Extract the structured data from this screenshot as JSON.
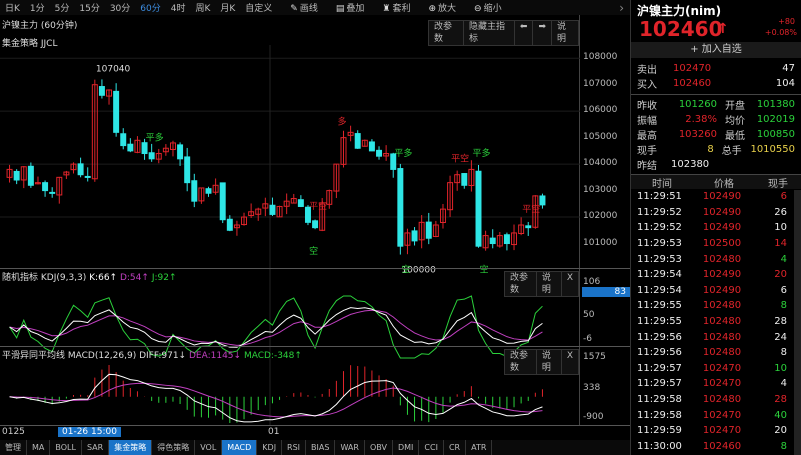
{
  "toolbar": {
    "items": [
      "日K",
      "1分",
      "5分",
      "15分",
      "30分",
      "60分",
      "4时",
      "周K",
      "月K",
      "自定义"
    ],
    "active": "60分",
    "tools": [
      {
        "icon": "pen-icon",
        "label": "画线"
      },
      {
        "icon": "layers-icon",
        "label": "叠加"
      },
      {
        "icon": "bag-icon",
        "label": "套利"
      },
      {
        "icon": "zoom-in-icon",
        "label": "放大"
      },
      {
        "icon": "zoom-out-icon",
        "label": "缩小"
      }
    ]
  },
  "main": {
    "title": "沪镍主力 (60分钟)",
    "strategy": "集金策略 JJCL",
    "buttons": [
      "改参数",
      "隐藏主指标",
      "⬅",
      "➡",
      "说明"
    ],
    "price_ticks": [
      "108000",
      "107000",
      "106000",
      "105000",
      "104000",
      "103000",
      "102000",
      "101000"
    ]
  },
  "kdj": {
    "title": "随机指标 KDJ(9,3,3)",
    "k": "K:66↑",
    "d": "D:54↑",
    "j": "J:92↑",
    "buttons": [
      "改参数",
      "说明",
      "X"
    ],
    "ticks": [
      "106",
      "50",
      "-6"
    ],
    "current": "83"
  },
  "macd": {
    "title": "平滑异同平均线 MACD(12,26,9)",
    "diff": "DIFF:971↓",
    "dea": "DEA:1145↓",
    "macd": "MACD:-348↑",
    "buttons": [
      "改参数",
      "说明",
      "X"
    ],
    "ticks": [
      "1575",
      "338",
      "-900"
    ]
  },
  "datebar": {
    "left": "0125",
    "cursor": "01-26 15:00",
    "mid": "01"
  },
  "tabs": {
    "items": [
      "管理",
      "MA",
      "BOLL",
      "SAR",
      "集金策略",
      "得色策略",
      "VOL",
      "MACD",
      "KDJ",
      "RSI",
      "BIAS",
      "WAR",
      "OBV",
      "DMI",
      "CCI",
      "CR",
      "ATR"
    ],
    "active": [
      "集金策略",
      "MACD"
    ]
  },
  "colors": {
    "up": "#e0242a",
    "down": "#2ee6e6",
    "k": "#ffffff",
    "d": "#c040c0",
    "j": "#2bd13b",
    "accent": "#1a73c8"
  },
  "chart_data": {
    "type": "candlestick",
    "closes": [
      103800,
      103400,
      103900,
      103200,
      103300,
      103000,
      102900,
      103500,
      103700,
      104000,
      103600,
      103500,
      107000,
      106600,
      106800,
      105200,
      104700,
      104500,
      104900,
      104400,
      104200,
      104400,
      104600,
      104800,
      104200,
      103300,
      102600,
      103100,
      102900,
      103200,
      101900,
      101500,
      101700,
      102000,
      102200,
      102300,
      102500,
      102100,
      102400,
      102600,
      102700,
      102400,
      101800,
      101600,
      102500,
      103000,
      104000,
      105000,
      105200,
      104600,
      104900,
      104500,
      104300,
      104400,
      103800,
      100900,
      101400,
      101100,
      101800,
      101200,
      101700,
      102300,
      103300,
      103600,
      103200,
      103800,
      100900,
      101300,
      101000,
      101300,
      101000,
      101400,
      101700,
      101600,
      102800,
      102460
    ],
    "ylim": [
      100000,
      108500
    ],
    "annotations": [
      {
        "i": 13,
        "text": "107040",
        "color": "#ddd"
      },
      {
        "i": 56,
        "text": "100000",
        "color": "#ddd"
      },
      {
        "i": 20,
        "text": "平多",
        "color": "#2bd13b"
      },
      {
        "i": 43,
        "text": "空",
        "color": "#2bd13b"
      },
      {
        "i": 43,
        "text": "平空",
        "color": "#e0242a"
      },
      {
        "i": 47,
        "text": "多",
        "color": "#e0242a"
      },
      {
        "i": 55,
        "text": "平多",
        "color": "#2bd13b"
      },
      {
        "i": 56,
        "text": "空",
        "color": "#2bd13b"
      },
      {
        "i": 63,
        "text": "平空",
        "color": "#e0242a"
      },
      {
        "i": 66,
        "text": "平多",
        "color": "#2bd13b"
      },
      {
        "i": 67,
        "text": "空",
        "color": "#2bd13b"
      },
      {
        "i": 73,
        "text": "平空",
        "color": "#e0242a"
      }
    ]
  },
  "quote": {
    "title": "沪镍主力(nim)",
    "price": "102460",
    "arrow": "↑",
    "change": "+80",
    "change_pct": "+0.08%",
    "add_watch": "+ 加入自选",
    "sell": {
      "label": "卖出",
      "price": "102470",
      "vol": "47"
    },
    "buy": {
      "label": "买入",
      "price": "102460",
      "vol": "104"
    },
    "stats": [
      [
        "昨收",
        "101260",
        "开盘",
        "101380"
      ],
      [
        "振幅",
        "2.38%",
        "均价",
        "102019"
      ],
      [
        "最高",
        "103260",
        "最低",
        "100850"
      ],
      [
        "现手",
        "8",
        "总手",
        "1010550"
      ]
    ],
    "settle": {
      "label": "昨结",
      "value": "102380"
    }
  },
  "ticks": {
    "headers": [
      "时间",
      "价格",
      "现手"
    ],
    "rows": [
      [
        "11:29:51",
        "102490",
        "6",
        "red"
      ],
      [
        "11:29:52",
        "102490",
        "26",
        "white"
      ],
      [
        "11:29:52",
        "102490",
        "10",
        "white"
      ],
      [
        "11:29:53",
        "102500",
        "14",
        "red"
      ],
      [
        "11:29:53",
        "102480",
        "4",
        "green"
      ],
      [
        "11:29:54",
        "102490",
        "20",
        "red"
      ],
      [
        "11:29:54",
        "102490",
        "6",
        "white"
      ],
      [
        "11:29:55",
        "102480",
        "8",
        "green"
      ],
      [
        "11:29:55",
        "102480",
        "28",
        "white"
      ],
      [
        "11:29:56",
        "102480",
        "24",
        "white"
      ],
      [
        "11:29:56",
        "102480",
        "8",
        "white"
      ],
      [
        "11:29:57",
        "102470",
        "10",
        "green"
      ],
      [
        "11:29:57",
        "102470",
        "4",
        "white"
      ],
      [
        "11:29:58",
        "102480",
        "28",
        "red"
      ],
      [
        "11:29:58",
        "102470",
        "40",
        "green"
      ],
      [
        "11:29:59",
        "102470",
        "20",
        "white"
      ],
      [
        "11:30:00",
        "102460",
        "8",
        "green"
      ]
    ]
  }
}
